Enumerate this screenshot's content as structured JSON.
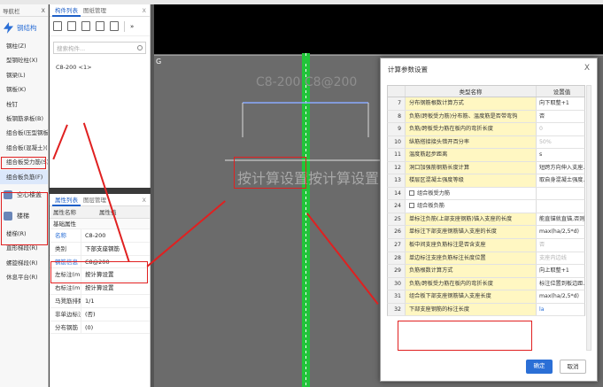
{
  "navigator": {
    "title": "导航栏",
    "close": "X",
    "section_main": "钢结构",
    "items": [
      "钢柱(Z)",
      "型钢砼柱(X)",
      "钢梁(L)",
      "钢板(K)",
      "栓钉",
      "板钢筋承板(B)",
      "组合板(压型钢板)",
      "组合板(混凝土)(B)",
      "组合板受力筋(S)",
      "组合板负筋(F)"
    ],
    "groups": [
      "空心楼盖",
      "楼梯"
    ],
    "bottom_items": [
      "楼梯(R)",
      "直形梯段(R)",
      "螺旋梯段(R)",
      "休息平台(R)"
    ]
  },
  "component_list": {
    "tabs": [
      "构件列表",
      "图纸管理"
    ],
    "close": "X",
    "more": "»",
    "search_placeholder": "搜索构件...",
    "items": [
      "C8-200 <1>"
    ]
  },
  "properties": {
    "tabs": [
      "属性列表",
      "图层管理"
    ],
    "close": "X",
    "headers": [
      "属性名称",
      "属性值"
    ],
    "group": "基础属性",
    "rows": [
      {
        "name": "名称",
        "value": "C8-200"
      },
      {
        "name": "类别",
        "value": "下部支座钢筋"
      },
      {
        "name": "钢筋信息",
        "value": "C8@200"
      },
      {
        "name": "左标注(mm)",
        "value": "按计算设置"
      },
      {
        "name": "右标注(mm)",
        "value": "按计算设置"
      },
      {
        "name": "马凳筋排数",
        "value": "1/1"
      },
      {
        "name": "非单边标注...",
        "value": "(否)"
      },
      {
        "name": "分布钢筋",
        "value": "(0)"
      }
    ]
  },
  "canvas": {
    "grid_label": "G",
    "rebar_label": "C8-200 C8@200",
    "annotation": "按计算设置按计算设置"
  },
  "dialog": {
    "title": "计算参数设置",
    "close": "X",
    "headers": [
      "类型名称",
      "设置值"
    ],
    "rows": [
      {
        "no": "7",
        "name": "分布钢筋根数计算方式",
        "value": "向下取整+1"
      },
      {
        "no": "8",
        "name": "负筋(跨板受力筋)分布筋、温度筋是否带弯钩",
        "value": "否"
      },
      {
        "no": "9",
        "name": "负筋/跨板受力筋在板内的弯折长度",
        "value": "0",
        "gray": true
      },
      {
        "no": "10",
        "name": "纵筋搭接接头错开百分率",
        "value": "50%",
        "gray": true
      },
      {
        "no": "11",
        "name": "温度筋起步距离",
        "value": "s"
      },
      {
        "no": "12",
        "name": "洞口加强筋钢筋长度计算",
        "value": "短跨方向伸入支座..."
      },
      {
        "no": "13",
        "name": "楼层区混凝土强度等级",
        "value": "取自身混凝土强度..."
      },
      {
        "no": "14",
        "name": "组合板受力筋",
        "value": "",
        "group": true
      },
      {
        "no": "24",
        "name": "组合板负筋",
        "value": "",
        "group": true
      },
      {
        "no": "25",
        "name": "单标注负筋(上部支座钢筋)锚入支座的长度",
        "value": "能直锚就直锚,否则..."
      },
      {
        "no": "26",
        "name": "单标注下部支座钢筋锚入支座的长度",
        "value": "max(ha/2,5*d)"
      },
      {
        "no": "27",
        "name": "板中间支座负筋标注是否含支座",
        "value": "否",
        "gray": true
      },
      {
        "no": "28",
        "name": "单边标注支座负筋标注长度位置",
        "value": "支座内边线",
        "gray": true
      },
      {
        "no": "29",
        "name": "负筋根数计算方式",
        "value": "向上取整+1"
      },
      {
        "no": "30",
        "name": "负筋/跨板受力筋在板内的弯折长度",
        "value": "标注位置到板边距..."
      },
      {
        "no": "31",
        "name": "组合板下部支座钢筋锚入支座长度",
        "value": "max(ha/2,5*d)"
      },
      {
        "no": "32",
        "name": "下部支座钢筋的标注长度",
        "value": "la",
        "blue": true
      }
    ],
    "ok": "确定",
    "cancel": "取消"
  },
  "colors": {
    "highlight": "#e02020",
    "accent": "#2b6fd6",
    "rebar": "#22c43a"
  }
}
